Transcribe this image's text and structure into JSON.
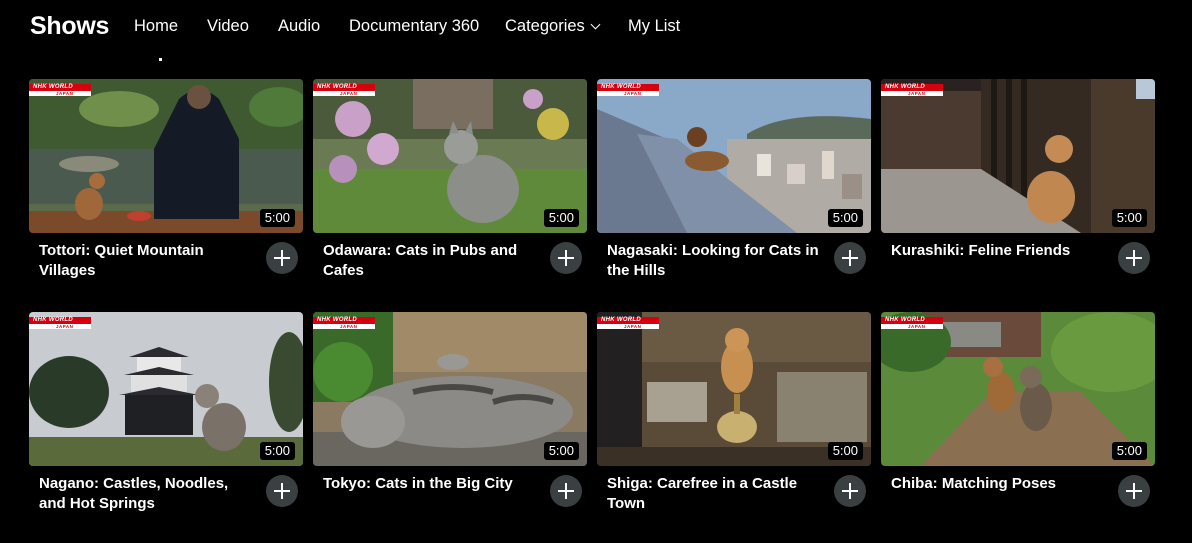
{
  "header": {
    "brand": "Shows",
    "nav": {
      "home": "Home",
      "video": "Video",
      "audio": "Audio",
      "documentary": "Documentary 360",
      "categories": "Categories",
      "my_list": "My List"
    }
  },
  "thumbnail_logo": {
    "line1": "NHK WORLD",
    "line2": "JAPAN"
  },
  "shows": [
    {
      "title": "Tottori: Quiet Mountain Villages",
      "duration": "5:00"
    },
    {
      "title": "Odawara: Cats in Pubs and Cafes",
      "duration": "5:00"
    },
    {
      "title": "Nagasaki: Looking for Cats in the Hills",
      "duration": "5:00"
    },
    {
      "title": "Kurashiki: Feline Friends",
      "duration": "5:00"
    },
    {
      "title": "Nagano: Castles, Noodles, and Hot Springs",
      "duration": "5:00"
    },
    {
      "title": "Tokyo: Cats in the Big City",
      "duration": "5:00"
    },
    {
      "title": "Shiga: Carefree in a Castle Town",
      "duration": "5:00"
    },
    {
      "title": "Chiba: Matching Poses",
      "duration": "5:00"
    }
  ],
  "colors": {
    "background": "#000000",
    "logo_red": "#d7000f",
    "add_button": "#3a3f42"
  },
  "icons": {
    "categories_toggle": "chevron-down-icon",
    "add_to_list": "plus-icon"
  }
}
